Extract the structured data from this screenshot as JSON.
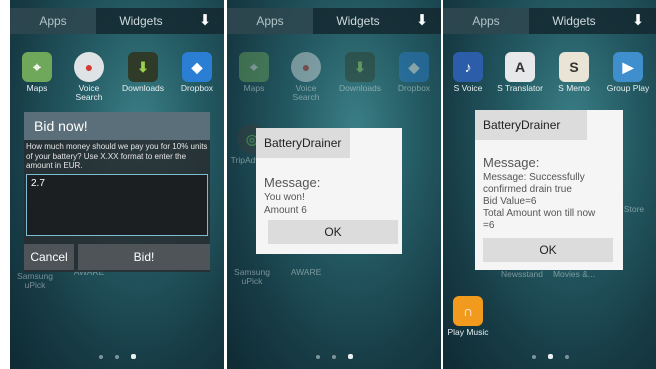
{
  "tabs": {
    "apps": "Apps",
    "widgets": "Widgets"
  },
  "screen1": {
    "apps": [
      "Maps",
      "Voice Search",
      "Downloads",
      "Dropbox",
      "Samsung uPick",
      "AWARE"
    ],
    "dialog": {
      "title": "Bid now!",
      "message": "How much money should we pay you for 10% units of your battery? Use X.XX format to enter the amount in EUR.",
      "input_value": "2.7",
      "cancel_label": "Cancel",
      "bid_label": "Bid!"
    }
  },
  "screen2": {
    "apps": [
      "Maps",
      "Voice Search",
      "Downloads",
      "Dropbox",
      "TripAdvisor",
      "Samsung uPick",
      "AWARE"
    ],
    "dialog": {
      "title": "BatteryDrainer",
      "heading": "Message:",
      "line1": "You won!",
      "line2": "Amount 6",
      "ok_label": "OK"
    }
  },
  "screen3": {
    "apps": [
      "S Voice",
      "S Translator",
      "S Memo",
      "Group Play",
      "Newsstand",
      "Movies &...",
      "Play Music",
      "Store"
    ],
    "dialog": {
      "title": "BatteryDrainer",
      "heading": "Message:",
      "line1": "Message: Successfully",
      "line2": "confirmed drain true",
      "line3": "Bid Value=6",
      "line4": "Total Amount won till now",
      "line5": "=6",
      "ok_label": "OK"
    }
  },
  "colors": {
    "accent": "#7bbdd3",
    "dialog_title": "#5a6f7a"
  }
}
